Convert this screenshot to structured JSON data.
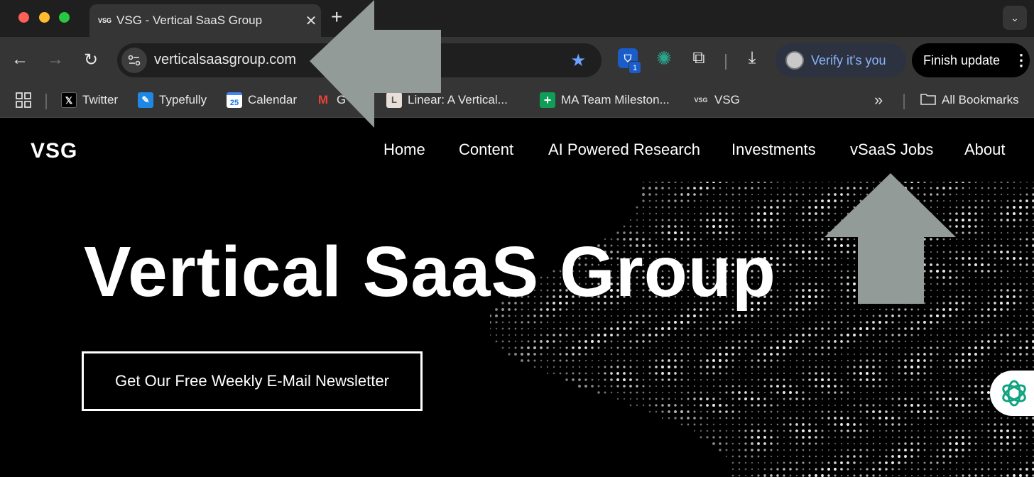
{
  "tab": {
    "favicon_text": "VSG",
    "title": "VSG - Vertical SaaS Group",
    "close_glyph": "✕",
    "new_tab_glyph": "+",
    "tab_search_glyph": "⌄"
  },
  "toolbar": {
    "back_glyph": "←",
    "forward_glyph": "→",
    "reload_glyph": "↻",
    "url": "verticalsaasgroup.com",
    "bookmark_star_glyph": "★",
    "extension_badge_count": "1",
    "verify_label": "Verify it's you",
    "finish_update_label": "Finish update",
    "menu_glyph": "⋮"
  },
  "bookmarks": {
    "items": [
      {
        "label": "Twitter",
        "icon": "x-logo-icon",
        "icon_text": "𝕏"
      },
      {
        "label": "Typefully",
        "icon": "typefully-icon",
        "icon_text": "✎"
      },
      {
        "label": "Calendar",
        "icon": "calendar-icon",
        "icon_text": "25"
      },
      {
        "label": "G",
        "icon": "gmail-icon",
        "icon_text": "M"
      },
      {
        "label": "Linear: A Vertical...",
        "icon": "linear-icon",
        "icon_text": "L"
      },
      {
        "label": "MA Team Mileston...",
        "icon": "sheets-icon",
        "icon_text": "+"
      },
      {
        "label": "VSG",
        "icon": "vsg-icon",
        "icon_text": "VSG"
      }
    ],
    "overflow_glyph": "»",
    "all_bookmarks_label": "All Bookmarks"
  },
  "site": {
    "logo": "VSG",
    "nav": [
      "Home",
      "Content",
      "AI Powered Research",
      "Investments",
      "vSaaS Jobs",
      "About"
    ],
    "hero_title": "Vertical SaaS Group",
    "cta_label": "Get Our Free Weekly E-Mail Newsletter"
  },
  "colors": {
    "tab_strip": "#1f1f1f",
    "toolbar": "#353535",
    "accent_blue": "#8ab4f8",
    "annotation_arrow": "#929b97",
    "page_background": "#000000"
  }
}
